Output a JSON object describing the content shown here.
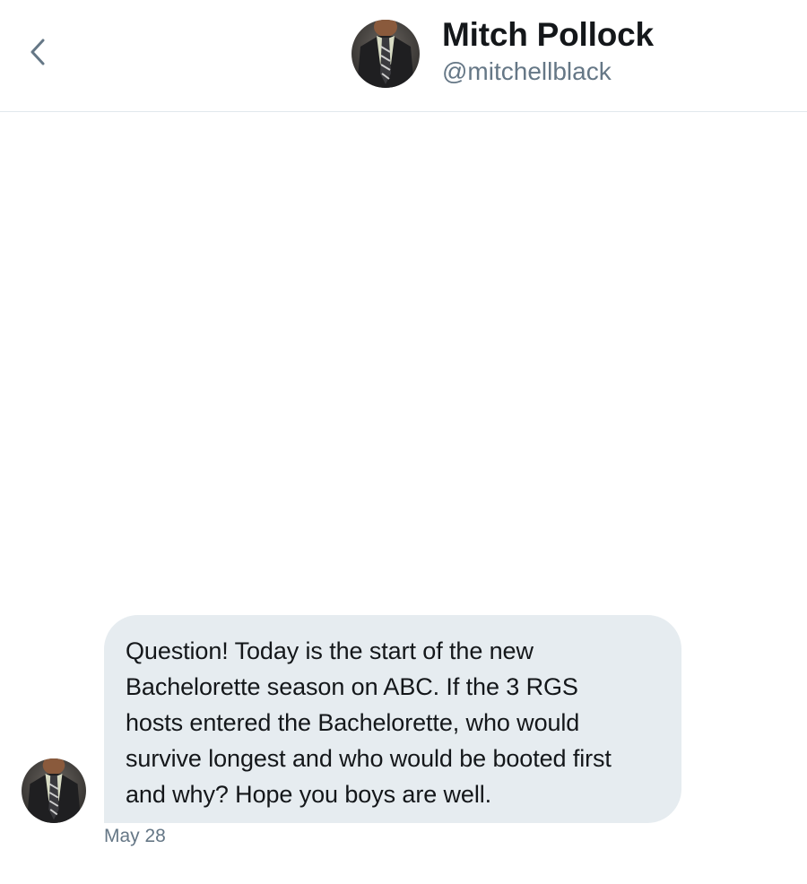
{
  "header": {
    "back_icon": "chevron-left-icon",
    "name": "Mitch Pollock",
    "handle": "@mitchellblack",
    "avatar_icon": "person-in-suit-avatar"
  },
  "conversation": {
    "messages": [
      {
        "text": "Question! Today is the start of the new\nBachelorette season on ABC. If the 3 RGS\nhosts entered the Bachelorette, who would\nsurvive longest and who would be booted first\nand why?  Hope you boys are well.",
        "timestamp": "May 28"
      }
    ]
  },
  "colors": {
    "bubble_background": "#e6ecf0",
    "secondary_text": "#657786",
    "primary_text": "#14171a",
    "divider": "#e1e8ed"
  }
}
